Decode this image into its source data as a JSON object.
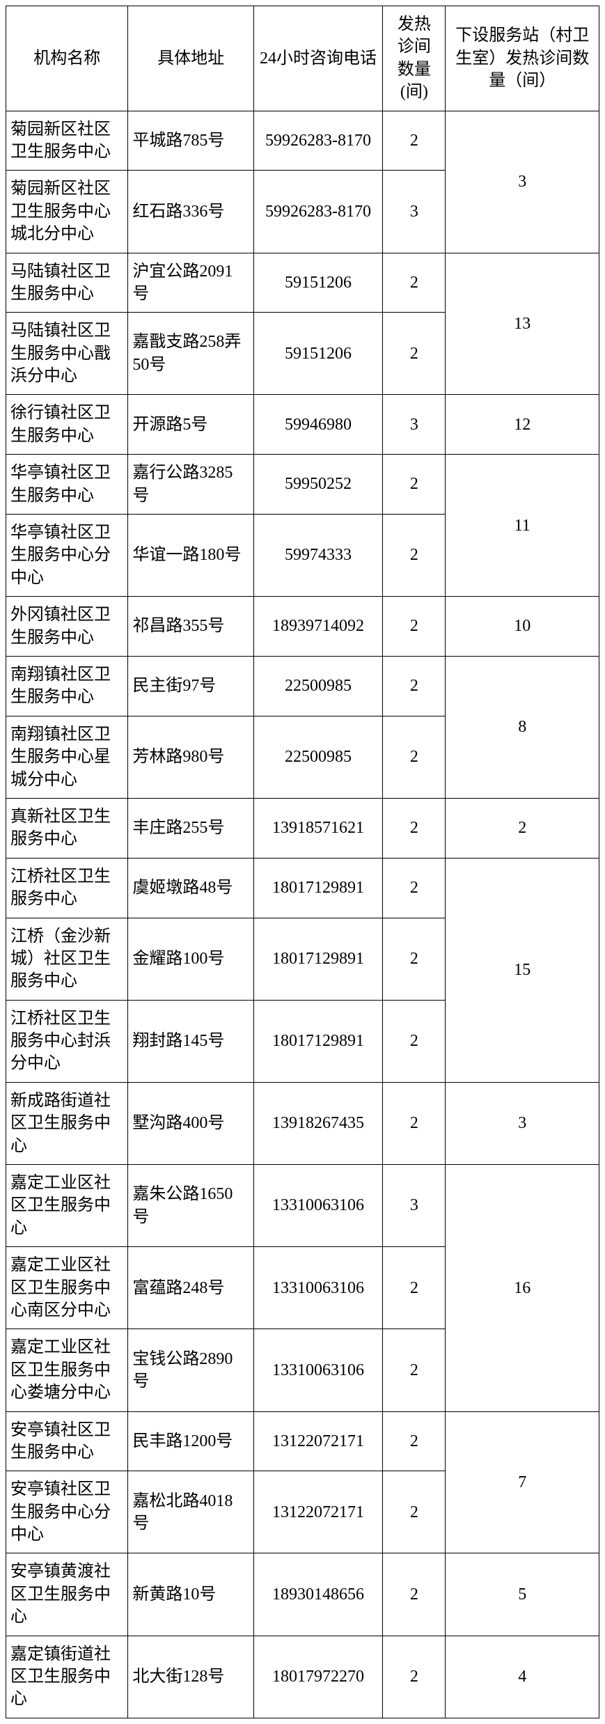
{
  "headers": {
    "name": "机构名称",
    "addr": "具体地址",
    "phone": "24小时咨询电话",
    "rooms": "发热\n诊间\n数量\n(间)",
    "sub": "下设服务站（村卫生室）发热诊间数量（间）"
  },
  "chart_data": {
    "type": "table",
    "columns": [
      "机构名称",
      "具体地址",
      "24小时咨询电话",
      "发热诊间数量(间)",
      "下设服务站（村卫生室）发热诊间数量（间）"
    ],
    "rows": [
      {
        "name": "菊园新区社区卫生服务中心",
        "addr": "平城路785号",
        "phone": "59926283-8170",
        "rooms": "2",
        "sub": "3",
        "sub_span": 2
      },
      {
        "name": "菊园新区社区卫生服务中心城北分中心",
        "addr": "红石路336号",
        "phone": "59926283-8170",
        "rooms": "3"
      },
      {
        "name": "马陆镇社区卫生服务中心",
        "addr": "沪宜公路2091号",
        "phone": "59151206",
        "rooms": "2",
        "sub": "13",
        "sub_span": 2
      },
      {
        "name": "马陆镇社区卫生服务中心戬浜分中心",
        "addr": "嘉戬支路258弄50号",
        "phone": "59151206",
        "rooms": "2"
      },
      {
        "name": "徐行镇社区卫生服务中心",
        "addr": "开源路5号",
        "phone": "59946980",
        "rooms": "3",
        "sub": "12",
        "sub_span": 1
      },
      {
        "name": "华亭镇社区卫生服务中心",
        "addr": "嘉行公路3285号",
        "phone": "59950252",
        "rooms": "2",
        "sub": "11",
        "sub_span": 2
      },
      {
        "name": "华亭镇社区卫生服务中心分中心",
        "addr": "华谊一路180号",
        "phone": "59974333",
        "rooms": "2"
      },
      {
        "name": "外冈镇社区卫生服务中心",
        "addr": "祁昌路355号",
        "phone": "18939714092",
        "rooms": "2",
        "sub": "10",
        "sub_span": 1
      },
      {
        "name": "南翔镇社区卫生服务中心",
        "addr": "民主街97号",
        "phone": "22500985",
        "rooms": "2",
        "sub": "8",
        "sub_span": 2
      },
      {
        "name": "南翔镇社区卫生服务中心星城分中心",
        "addr": "芳林路980号",
        "phone": "22500985",
        "rooms": "2"
      },
      {
        "name": "真新社区卫生服务中心",
        "addr": "丰庄路255号",
        "phone": "13918571621",
        "rooms": "2",
        "sub": "2",
        "sub_span": 1
      },
      {
        "name": "江桥社区卫生服务中心",
        "addr": "虞姬墩路48号",
        "phone": "18017129891",
        "rooms": "2",
        "sub": "15",
        "sub_span": 3
      },
      {
        "name": "江桥（金沙新城）社区卫生服务中心",
        "addr": "金耀路100号",
        "phone": "18017129891",
        "rooms": "2"
      },
      {
        "name": "江桥社区卫生服务中心封浜分中心",
        "addr": "翔封路145号",
        "phone": "18017129891",
        "rooms": "2"
      },
      {
        "name": "新成路街道社区卫生服务中心",
        "addr": "墅沟路400号",
        "phone": "13918267435",
        "rooms": "2",
        "sub": "3",
        "sub_span": 1
      },
      {
        "name": "嘉定工业区社区卫生服务中心",
        "addr": "嘉朱公路1650号",
        "phone": "13310063106",
        "rooms": "3",
        "sub": "16",
        "sub_span": 3
      },
      {
        "name": "嘉定工业区社区卫生服务中心南区分中心",
        "addr": "富蕴路248号",
        "phone": "13310063106",
        "rooms": "2"
      },
      {
        "name": "嘉定工业区社区卫生服务中心娄塘分中心",
        "addr": "宝钱公路2890号",
        "phone": "13310063106",
        "rooms": "2"
      },
      {
        "name": "安亭镇社区卫生服务中心",
        "addr": "民丰路1200号",
        "phone": "13122072171",
        "rooms": "2",
        "sub": "7",
        "sub_span": 2
      },
      {
        "name": "安亭镇社区卫生服务中心分中心",
        "addr": "嘉松北路4018号",
        "phone": "13122072171",
        "rooms": "2"
      },
      {
        "name": "安亭镇黄渡社区卫生服务中心",
        "addr": "新黄路10号",
        "phone": "18930148656",
        "rooms": "2",
        "sub": "5",
        "sub_span": 1
      },
      {
        "name": "嘉定镇街道社区卫生服务中心",
        "addr": "北大街128号",
        "phone": "18017972270",
        "rooms": "2",
        "sub": "4",
        "sub_span": 1
      }
    ]
  }
}
